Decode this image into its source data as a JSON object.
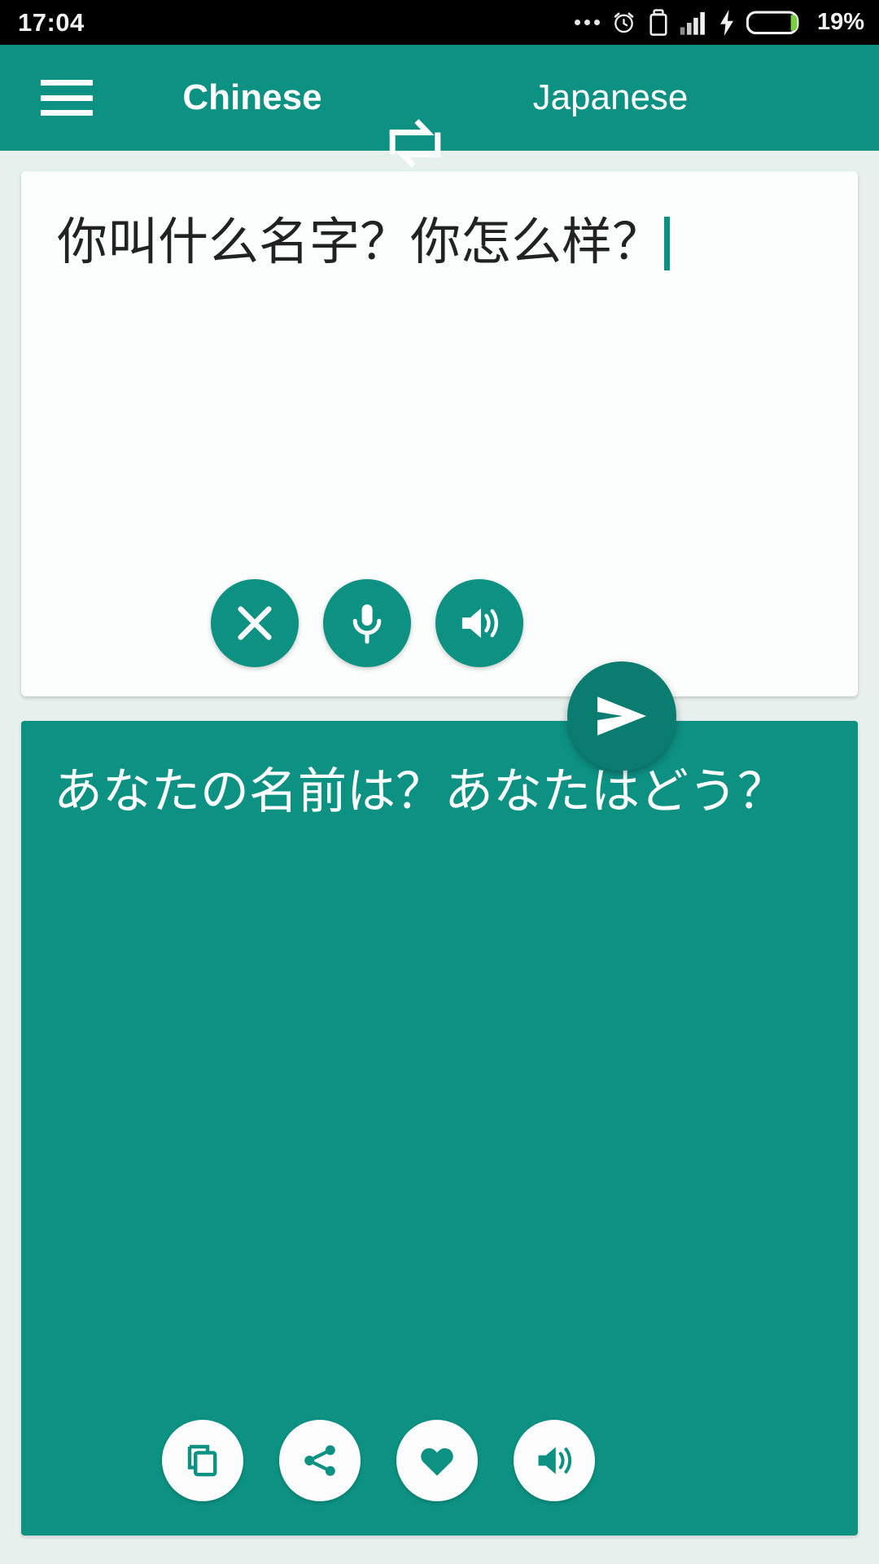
{
  "status_bar": {
    "clock": "17:04",
    "battery_percent": "19%",
    "icons": [
      "more-dots-icon",
      "alarm-clock-icon",
      "usb-debug-icon",
      "signal-bars-icon",
      "charging-bolt-icon",
      "battery-icon"
    ]
  },
  "toolbar": {
    "menu_icon": "hamburger-menu-icon",
    "source_language": "Chinese",
    "swap_icon": "swap-languages-icon",
    "target_language": "Japanese"
  },
  "source_panel": {
    "text": "你叫什么名字？你怎么样？",
    "has_caret": true,
    "actions": [
      {
        "name": "clear-button",
        "icon": "close-x-icon",
        "label": "Clear"
      },
      {
        "name": "voice-input-button",
        "icon": "microphone-icon",
        "label": "Voice input"
      },
      {
        "name": "speak-source-button",
        "icon": "speaker-icon",
        "label": "Listen"
      }
    ]
  },
  "translate_button": {
    "icon": "send-arrow-icon",
    "label": "Translate"
  },
  "target_panel": {
    "text": "あなたの名前は？あなたはどう？",
    "actions": [
      {
        "name": "copy-button",
        "icon": "copy-icon",
        "label": "Copy"
      },
      {
        "name": "share-button",
        "icon": "share-icon",
        "label": "Share"
      },
      {
        "name": "favorite-button",
        "icon": "heart-icon",
        "label": "Favorite"
      },
      {
        "name": "speak-target-button",
        "icon": "speaker-icon",
        "label": "Listen"
      }
    ]
  },
  "colors": {
    "primary": "#0d9183",
    "primary_dark": "#0b7d70",
    "background": "#e6f0ed",
    "status_bar": "#000000",
    "battery_fill": "#77d13c"
  }
}
